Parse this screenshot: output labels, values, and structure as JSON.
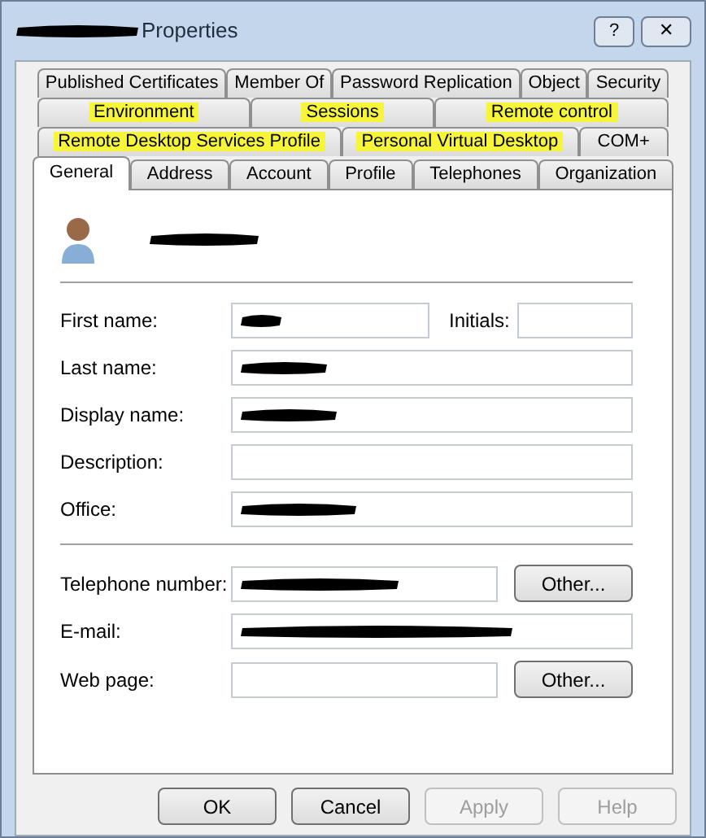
{
  "window": {
    "title": "Properties",
    "title_redacted": true,
    "help_button": "?",
    "close_button": "✕"
  },
  "tab_rows": [
    [
      {
        "label": "Published Certificates",
        "highlighted": false,
        "selected": false
      },
      {
        "label": "Member Of",
        "highlighted": false,
        "selected": false
      },
      {
        "label": "Password Replication",
        "highlighted": false,
        "selected": false
      },
      {
        "label": "Object",
        "highlighted": false,
        "selected": false
      },
      {
        "label": "Security",
        "highlighted": false,
        "selected": false
      }
    ],
    [
      {
        "label": "Environment",
        "highlighted": true,
        "selected": false
      },
      {
        "label": "Sessions",
        "highlighted": true,
        "selected": false
      },
      {
        "label": "Remote control",
        "highlighted": true,
        "selected": false
      }
    ],
    [
      {
        "label": "Remote Desktop Services Profile",
        "highlighted": true,
        "selected": false
      },
      {
        "label": "Personal Virtual Desktop",
        "highlighted": true,
        "selected": false
      },
      {
        "label": "COM+",
        "highlighted": false,
        "selected": false
      }
    ],
    [
      {
        "label": "General",
        "highlighted": false,
        "selected": true
      },
      {
        "label": "Address",
        "highlighted": false,
        "selected": false
      },
      {
        "label": "Account",
        "highlighted": false,
        "selected": false
      },
      {
        "label": "Profile",
        "highlighted": false,
        "selected": false
      },
      {
        "label": "Telephones",
        "highlighted": false,
        "selected": false
      },
      {
        "label": "Organization",
        "highlighted": false,
        "selected": false
      }
    ]
  ],
  "user": {
    "name_redacted": true
  },
  "name_fields": [
    {
      "label": "First name:",
      "redacted": true,
      "extra": {
        "label": "Initials:"
      }
    },
    {
      "label": "Last name:",
      "redacted": true
    },
    {
      "label": "Display name:",
      "redacted": true
    },
    {
      "label": "Description:",
      "redacted": false
    },
    {
      "label": "Office:",
      "redacted": true
    }
  ],
  "contact_fields": [
    {
      "label": "Telephone number:",
      "redacted": true,
      "button": "Other..."
    },
    {
      "label": "E-mail:",
      "redacted": true
    },
    {
      "label": "Web page:",
      "redacted": false,
      "button": "Other..."
    }
  ],
  "buttons": [
    {
      "label": "OK",
      "disabled": false
    },
    {
      "label": "Cancel",
      "disabled": false
    },
    {
      "label": "Apply",
      "disabled": true
    },
    {
      "label": "Help",
      "disabled": true
    }
  ]
}
